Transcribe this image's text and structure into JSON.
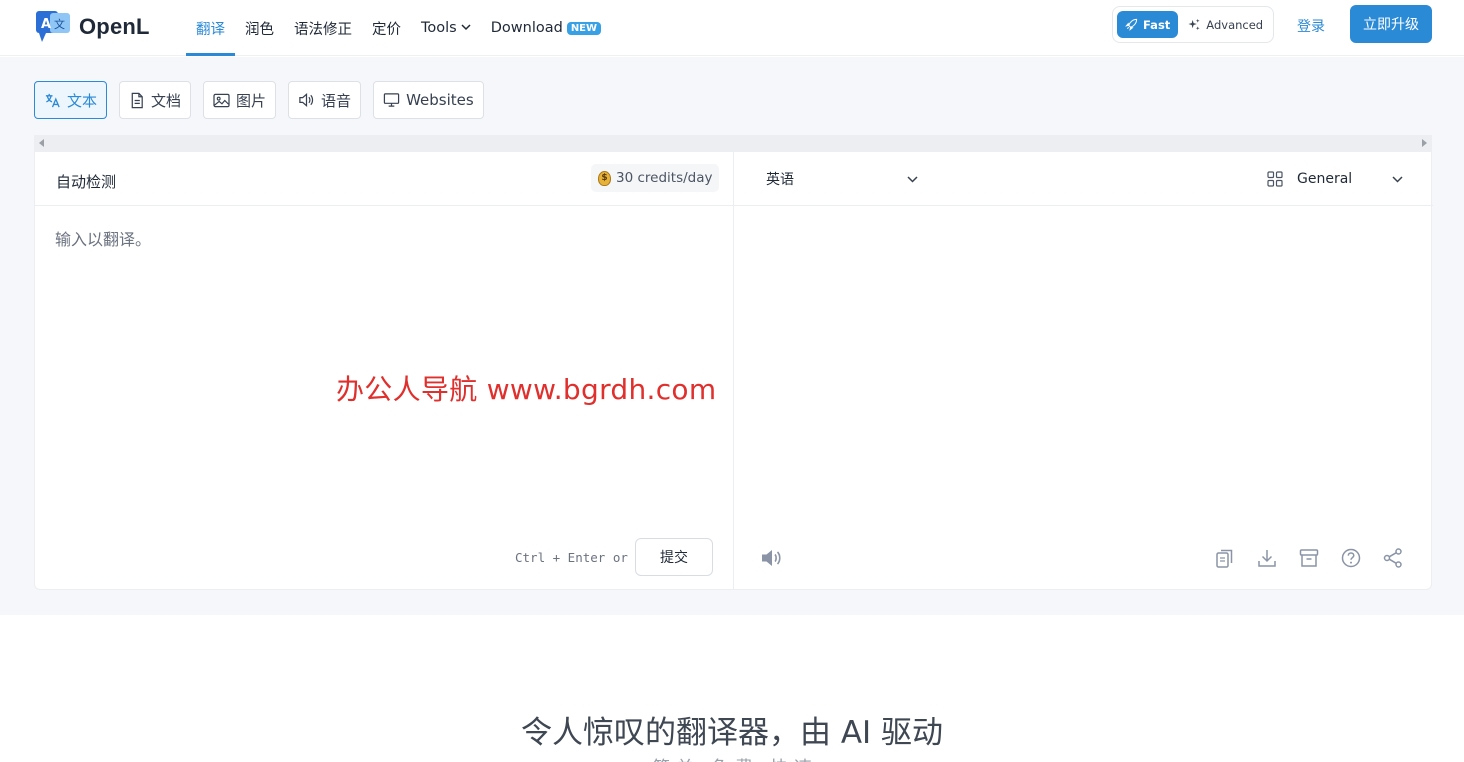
{
  "brand": {
    "name": "OpenL"
  },
  "nav": {
    "items": [
      "翻译",
      "润色",
      "语法修正",
      "定价"
    ],
    "tools_label": "Tools",
    "download_label": "Download",
    "download_badge": "NEW"
  },
  "mode": {
    "fast": "Fast",
    "advanced": "Advanced"
  },
  "auth": {
    "login": "登录",
    "upgrade": "立即升级"
  },
  "tabs": [
    {
      "label": "文本",
      "active": true
    },
    {
      "label": "文档",
      "active": false
    },
    {
      "label": "图片",
      "active": false
    },
    {
      "label": "语音",
      "active": false
    },
    {
      "label": "Websites",
      "active": false
    }
  ],
  "source": {
    "language": "自动检测",
    "credits": "30 credits/day",
    "placeholder": "输入以翻译。",
    "value": "",
    "shortcut_hint": "Ctrl + Enter or",
    "submit_label": "提交"
  },
  "target": {
    "language": "英语",
    "domain": "General"
  },
  "watermark": "办公人导航  www.bgrdh.com",
  "hero": {
    "headline": "令人惊叹的翻译器，由 AI 驱动",
    "subline": "简 单 · 免 费 · 快 速"
  },
  "colors": {
    "accent": "#2b8ad6",
    "watermark": "#e0302d"
  }
}
